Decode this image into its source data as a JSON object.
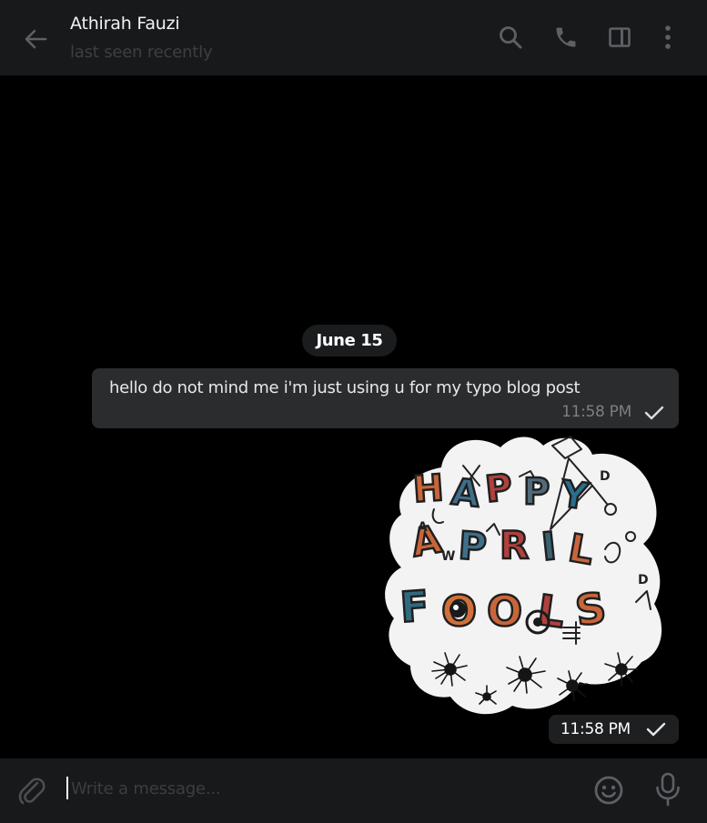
{
  "chat": {
    "contact_name": "Athirah Fauzi",
    "status": "last seen recently"
  },
  "icons": {
    "back": "arrow-left-icon",
    "search": "search-icon",
    "call": "phone-icon",
    "sidebar": "sidebar-panel-icon",
    "more": "more-vertical-icon",
    "attach": "paperclip-icon",
    "emoji": "emoji-icon",
    "mic": "microphone-icon",
    "check": "single-check-icon"
  },
  "messages": {
    "date_separator": "June 15",
    "text_message": {
      "text": "hello do not mind me i'm just using u for my typo blog post",
      "time": "11:58 PM"
    },
    "sticker_message": {
      "sticker_text": "HAPPY APRIL FOOLS",
      "time": "11:58 PM"
    }
  },
  "composer": {
    "placeholder": "Write a message..."
  },
  "colors": {
    "background": "#000000",
    "header": "#17191b",
    "bubble": "#2a2c2e",
    "muted": "#7c7f83",
    "icon": "#7a7d81"
  }
}
